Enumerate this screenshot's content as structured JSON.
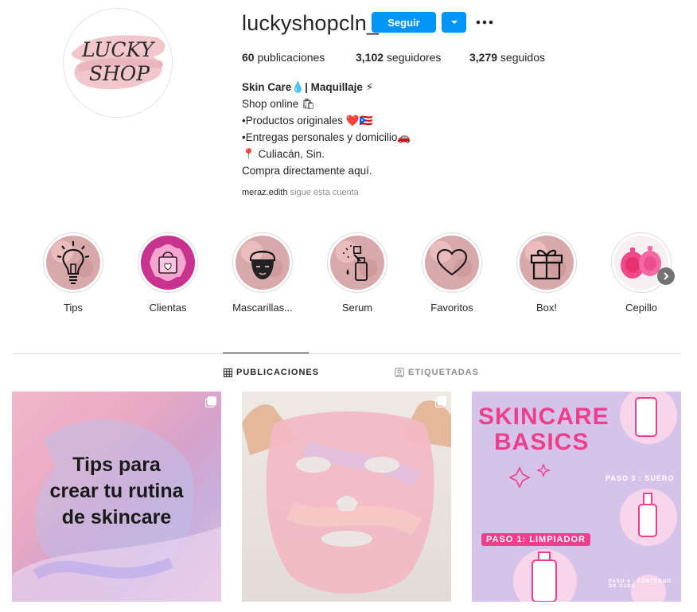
{
  "profile": {
    "username": "luckyshopcln_",
    "logo_text_line1": "LUCKY",
    "logo_text_line2": "SHOP",
    "follow_label": "Seguir"
  },
  "stats": {
    "posts_count": "60",
    "posts_label": " publicaciones",
    "followers_count": "3,102",
    "followers_label": " seguidores",
    "following_count": "3,279",
    "following_label": " seguidos"
  },
  "bio": {
    "name": "Skin Care💧| Maquillaje ⚡",
    "line1": "Shop online 🛍",
    "line2": "•Productos originales ❤️🇵🇷",
    "line3": "•Entregas personales y domicilio🚗",
    "line4": "📍 Culiacán, Sin.",
    "line5": "Compra directamente aquí.",
    "followed_by_user": "meraz.edith",
    "followed_by_text": " sigue esta cuenta"
  },
  "highlights": [
    {
      "label": "Tips",
      "icon": "lightbulb-icon"
    },
    {
      "label": "Clientas",
      "icon": "shopping-bag-heart-icon"
    },
    {
      "label": "Mascarillas...",
      "icon": "face-mask-icon"
    },
    {
      "label": "Serum",
      "icon": "dropper-bottle-icon"
    },
    {
      "label": "Favoritos",
      "icon": "heart-icon"
    },
    {
      "label": "Box!",
      "icon": "gift-icon"
    },
    {
      "label": "Cepillo",
      "icon": "cleansing-brush-icon"
    }
  ],
  "tabs": {
    "posts": "PUBLICACIONES",
    "tagged": "ETIQUETADAS"
  },
  "posts": {
    "p1_line1": "Tips para",
    "p1_line2": "crear tu rutina",
    "p1_line3": "de skincare",
    "p3_title1": "SKINCARE",
    "p3_title2": "BASICS",
    "p3_step3": "PASO 3 : SUERO",
    "p3_step1": "PASO 1: LIMPIADOR",
    "p3_step4": "PASO 4 : CONTORNO DE OJOS"
  },
  "colors": {
    "accent": "#0095f6",
    "text": "#262626",
    "muted": "#8e8e8e",
    "border": "#dbdbdb"
  }
}
